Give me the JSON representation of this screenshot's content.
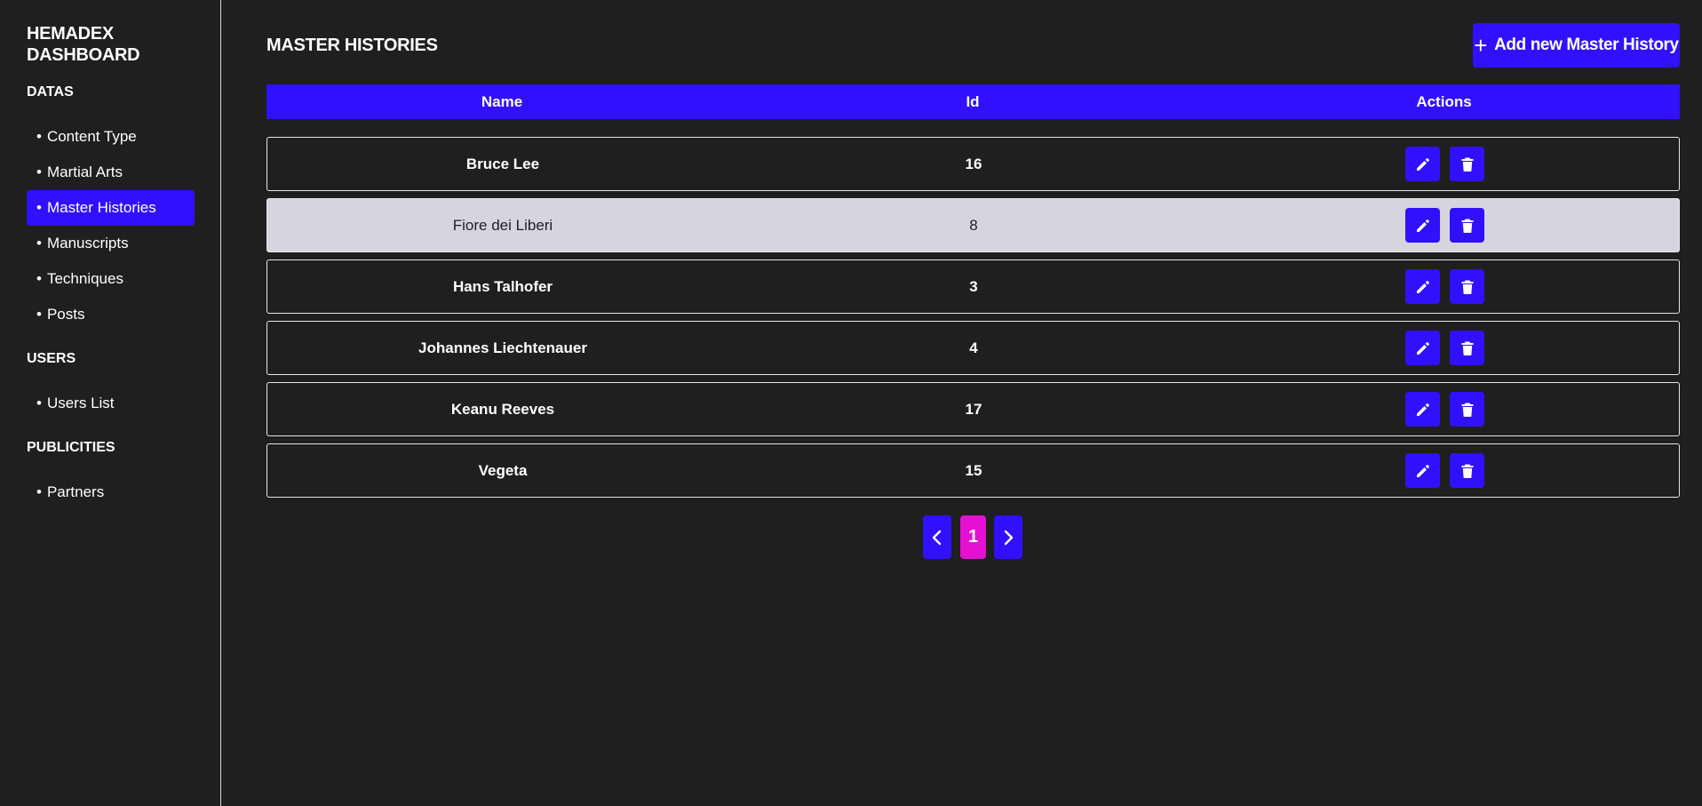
{
  "sidebar": {
    "brand": "HEMADEX DASHBOARD",
    "sections": [
      {
        "title": "DATAS",
        "items": [
          {
            "label": "Content Type",
            "active": false
          },
          {
            "label": "Martial Arts",
            "active": false
          },
          {
            "label": "Master Histories",
            "active": true
          },
          {
            "label": "Manuscripts",
            "active": false
          },
          {
            "label": "Techniques",
            "active": false
          },
          {
            "label": "Posts",
            "active": false
          }
        ]
      },
      {
        "title": "USERS",
        "items": [
          {
            "label": "Users List",
            "active": false
          }
        ]
      },
      {
        "title": "PUBLICITIES",
        "items": [
          {
            "label": "Partners",
            "active": false
          }
        ]
      }
    ]
  },
  "main": {
    "title": "MASTER HISTORIES",
    "add_button": {
      "icon": "plus-icon",
      "label": "Add new Master History"
    },
    "table": {
      "columns": [
        "Name",
        "Id",
        "Actions"
      ],
      "rows": [
        {
          "name": "Bruce Lee",
          "id": "16",
          "highlighted": false
        },
        {
          "name": "Fiore dei Liberi",
          "id": "8",
          "highlighted": true
        },
        {
          "name": "Hans Talhofer",
          "id": "3",
          "highlighted": false
        },
        {
          "name": "Johannes Liechtenauer",
          "id": "4",
          "highlighted": false
        },
        {
          "name": "Keanu Reeves",
          "id": "17",
          "highlighted": false
        },
        {
          "name": "Vegeta",
          "id": "15",
          "highlighted": false
        }
      ],
      "row_actions": [
        "pencil-icon",
        "trash-icon"
      ]
    },
    "pagination": {
      "current_page": "1",
      "prev_icon": "chevron-left-icon",
      "next_icon": "chevron-right-icon"
    }
  },
  "colors": {
    "background": "#1f1f1f",
    "accent": "#3110fd",
    "pagination_current": "#e411d3",
    "highlight_row": "#d6d4df"
  }
}
